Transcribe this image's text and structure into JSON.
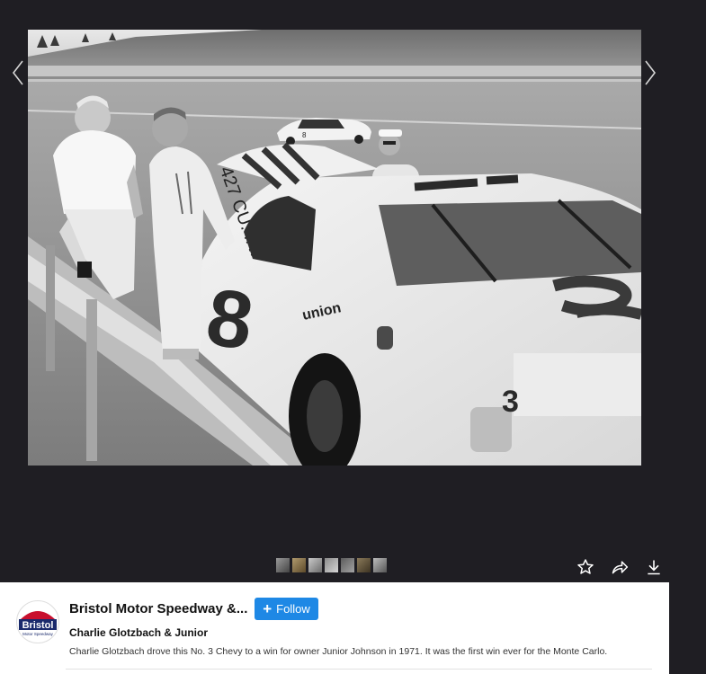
{
  "viewer": {
    "photo_alt": "Black and white photo of two drivers standing next to the No. 3 Chevy race car on pit road",
    "car_number": "3",
    "car_door_number": "8",
    "sponsor_text": "union",
    "hood_text": "427 CU. IN."
  },
  "icons": {
    "prev": "chevron-left-icon",
    "next": "chevron-right-icon",
    "favorite": "star-icon",
    "share": "share-icon",
    "download": "download-icon"
  },
  "account": {
    "name": "Bristol Motor Speedway &...",
    "follow_label": "Follow",
    "avatar_text": "Bristol",
    "avatar_subtext": "Motor Speedway"
  },
  "photo": {
    "title": "Charlie Glotzbach & Junior",
    "description": "Charlie Glotzbach drove this No. 3 Chevy to a win for owner Junior Johnson in 1971. It was the first win ever for the Monte Carlo."
  },
  "colors": {
    "accent": "#1e88e5",
    "viewer_bg": "#1f1e23"
  }
}
